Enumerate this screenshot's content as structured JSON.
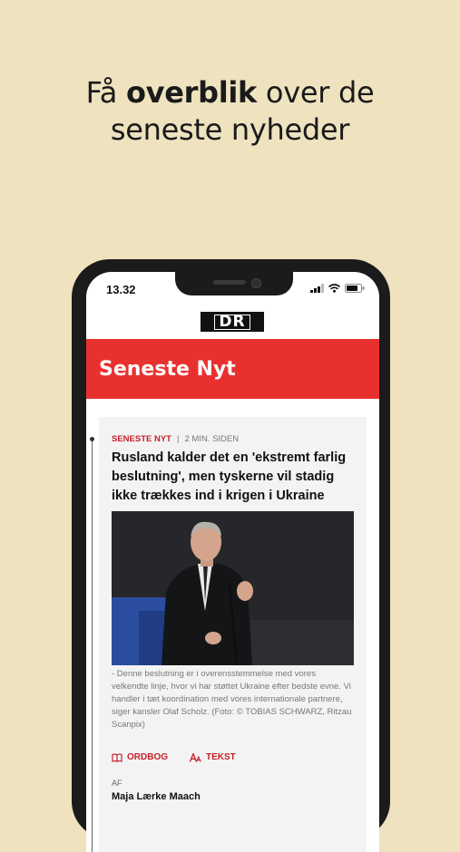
{
  "headline": {
    "pre": "Få ",
    "bold": "overblik",
    "post": " over de",
    "line2": "seneste nyheder"
  },
  "phone": {
    "status_time": "13.32",
    "logo_text": "DR",
    "section_title": "Seneste Nyt",
    "article": {
      "tag": "SENESTE NYT",
      "separator": "|",
      "time_ago": "2 MIN. SIDEN",
      "title": "Rusland kalder det en 'ekstremt farlig beslutning', men tyskerne vil stadig ikke trækkes ind i krigen i Ukraine",
      "caption": "- Denne beslutning er i overensstemmelse med vores velkendte linje, hvor vi har støttet Ukraine efter bedste evne. Vi handler i tæt koordination med vores internationale partnere, siger kansler Olaf Scholz. (Foto: © TOBIAS SCHWARZ, Ritzau Scanpix)",
      "action_dictionary": "ORDBOG",
      "action_text": "TEKST",
      "byline_prefix": "AF",
      "author": "Maja Lærke Maach"
    }
  },
  "colors": {
    "background": "#efe2bf",
    "accent_red": "#e8312f",
    "tag_red": "#c8202a"
  }
}
